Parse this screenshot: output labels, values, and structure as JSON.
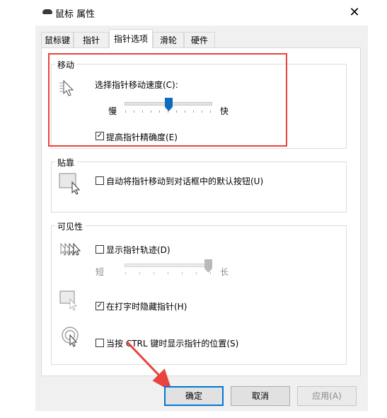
{
  "window": {
    "title": "鼠标 属性",
    "close_glyph": "✕"
  },
  "tabs": [
    {
      "label": "鼠标键"
    },
    {
      "label": "指针"
    },
    {
      "label": "指针选项",
      "active": true
    },
    {
      "label": "滑轮"
    },
    {
      "label": "硬件"
    }
  ],
  "motion": {
    "group_label": "移动",
    "speed_label": "选择指针移动速度(C):",
    "slow_label": "慢",
    "fast_label": "快",
    "speed_value": 0.5,
    "enhance_label": "提高指针精确度(E)",
    "enhance_checked": true
  },
  "snap": {
    "group_label": "贴靠",
    "option_label": "自动将指针移动到对话框中的默认按钮(U)",
    "option_checked": false
  },
  "visibility": {
    "group_label": "可见性",
    "trails_label": "显示指针轨迹(D)",
    "trails_checked": false,
    "short_label": "短",
    "long_label": "长",
    "trail_value": 1.0,
    "hide_label": "在打字时隐藏指针(H)",
    "hide_checked": true,
    "ctrl_label": "当按 CTRL 键时显示指针的位置(S)",
    "ctrl_checked": false
  },
  "buttons": {
    "ok": "确定",
    "cancel": "取消",
    "apply": "应用(A)"
  },
  "check_glyph": "✓",
  "colors": {
    "highlight_box": "#e8433d",
    "annotation_arrow": "#e8433d",
    "primary_border": "#0078d7",
    "thumb": "#0f6cbd"
  }
}
